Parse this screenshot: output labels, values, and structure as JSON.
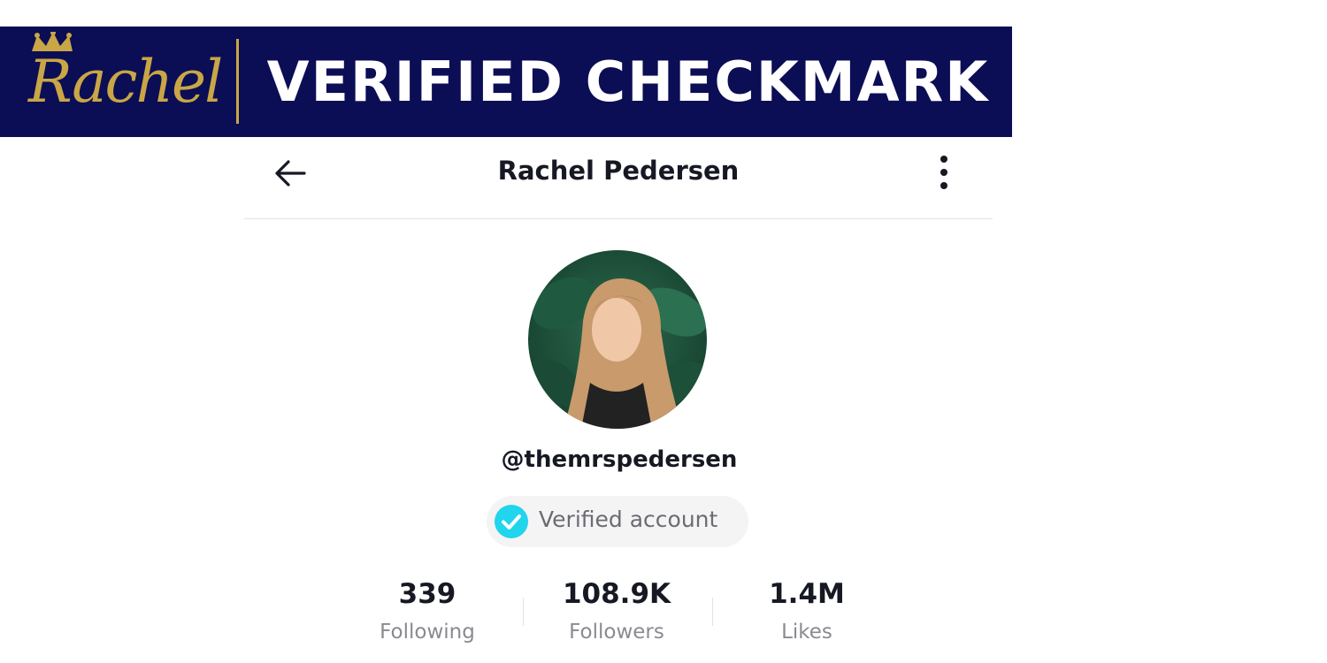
{
  "banner": {
    "logo_text": "Rachel",
    "title": "VERIFIED CHECKMARK",
    "colors": {
      "background": "#0b0e55",
      "gold": "#c9a646",
      "text": "#ffffff"
    }
  },
  "header": {
    "profile_name": "Rachel Pedersen",
    "back_icon": "arrow-left-icon",
    "more_icon": "more-vertical-icon"
  },
  "profile": {
    "username": "@themrspedersen",
    "verified_label": "Verified account",
    "verified_icon": "checkmark-circle-icon",
    "verified_color": "#20d5ec"
  },
  "stats": [
    {
      "value": "339",
      "label": "Following"
    },
    {
      "value": "108.9K",
      "label": "Followers"
    },
    {
      "value": "1.4M",
      "label": "Likes"
    }
  ]
}
